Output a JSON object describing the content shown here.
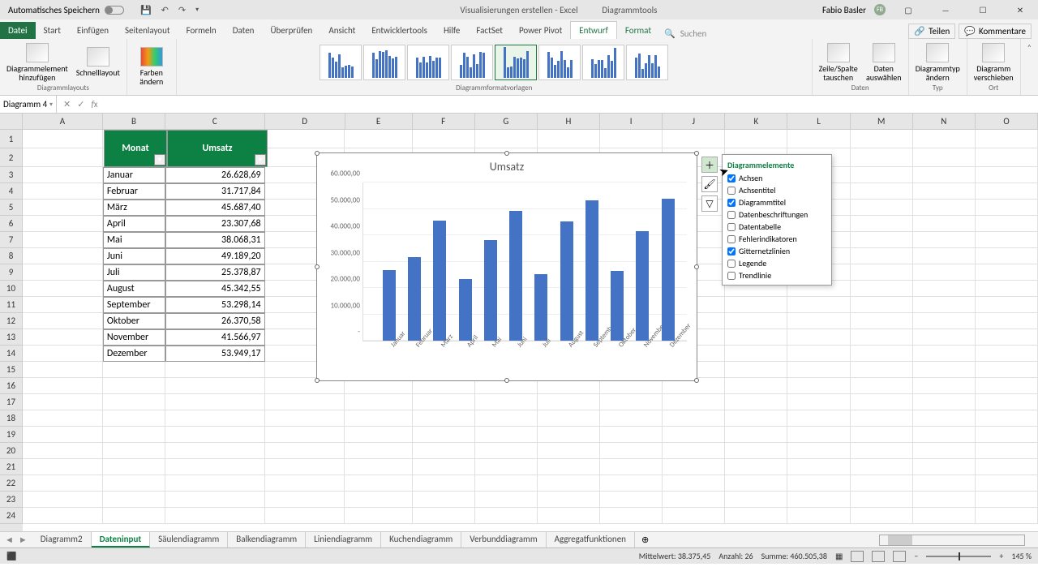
{
  "title": {
    "autosave": "Automatisches Speichern",
    "file": "Visualisierungen erstellen",
    "app": "Excel",
    "tools": "Diagrammtools",
    "user": "Fabio Basler",
    "user_initials": "FB"
  },
  "tabs": {
    "datei": "Datei",
    "start": "Start",
    "einfugen": "Einfügen",
    "seitenlayout": "Seitenlayout",
    "formeln": "Formeln",
    "daten": "Daten",
    "uberprufen": "Überprüfen",
    "ansicht": "Ansicht",
    "entwickler": "Entwicklertools",
    "hilfe": "Hilfe",
    "factset": "FactSet",
    "powerpivot": "Power Pivot",
    "entwurf": "Entwurf",
    "format": "Format",
    "search": "Suchen",
    "teilen": "Teilen",
    "kommentare": "Kommentare"
  },
  "ribbon": {
    "layouts": {
      "element": "Diagrammelement\nhinzufügen",
      "schnell": "Schnelllayout",
      "label": "Diagrammlayouts"
    },
    "farben": {
      "btn": "Farben\nändern"
    },
    "styles_label": "Diagrammformatvorlagen",
    "daten": {
      "zs": "Zeile/Spalte\ntauschen",
      "aus": "Daten\nauswählen",
      "label": "Daten"
    },
    "typ": {
      "btn": "Diagrammtyp\nändern",
      "label": "Typ"
    },
    "ort": {
      "btn": "Diagramm\nverschieben",
      "label": "Ort"
    }
  },
  "namebox": "Diagramm 4",
  "table": {
    "h1": "Monat",
    "h2": "Umsatz",
    "rows": [
      {
        "m": "Januar",
        "u": "26.628,69"
      },
      {
        "m": "Februar",
        "u": "31.717,84"
      },
      {
        "m": "März",
        "u": "45.687,40"
      },
      {
        "m": "April",
        "u": "23.307,68"
      },
      {
        "m": "Mai",
        "u": "38.068,31"
      },
      {
        "m": "Juni",
        "u": "49.189,20"
      },
      {
        "m": "Juli",
        "u": "25.378,87"
      },
      {
        "m": "August",
        "u": "45.342,55"
      },
      {
        "m": "September",
        "u": "53.298,14"
      },
      {
        "m": "Oktober",
        "u": "26.370,58"
      },
      {
        "m": "November",
        "u": "41.566,97"
      },
      {
        "m": "Dezember",
        "u": "53.949,17"
      }
    ]
  },
  "chart_data": {
    "type": "bar",
    "title": "Umsatz",
    "categories": [
      "Januar",
      "Februar",
      "März",
      "April",
      "Mai",
      "Juni",
      "Juli",
      "August",
      "September",
      "Oktober",
      "November",
      "Dezember"
    ],
    "values": [
      26628.69,
      31717.84,
      45687.4,
      23307.68,
      38068.31,
      49189.2,
      25378.87,
      45342.55,
      53298.14,
      26370.58,
      41566.97,
      53949.17
    ],
    "yticks": [
      "-",
      "10.000,00",
      "20.000,00",
      "30.000,00",
      "40.000,00",
      "50.000,00",
      "60.000,00"
    ],
    "ylim": [
      0,
      60000
    ]
  },
  "elements_panel": {
    "title": "Diagrammelemente",
    "items": [
      {
        "label": "Achsen",
        "checked": true
      },
      {
        "label": "Achsentitel",
        "checked": false
      },
      {
        "label": "Diagrammtitel",
        "checked": true
      },
      {
        "label": "Datenbeschriftungen",
        "checked": false
      },
      {
        "label": "Datentabelle",
        "checked": false
      },
      {
        "label": "Fehlerindikatoren",
        "checked": false
      },
      {
        "label": "Gitternetzlinien",
        "checked": true
      },
      {
        "label": "Legende",
        "checked": false
      },
      {
        "label": "Trendlinie",
        "checked": false
      }
    ]
  },
  "sheets": [
    "Diagramm2",
    "Dateninput",
    "Säulendiagramm",
    "Balkendiagramm",
    "Liniendiagramm",
    "Kuchendiagramm",
    "Verbunddiagramm",
    "Aggregatfunktionen"
  ],
  "sheets_active": 1,
  "status": {
    "mittelwert_l": "Mittelwert:",
    "mittelwert_v": "38.375,45",
    "anzahl_l": "Anzahl:",
    "anzahl_v": "26",
    "summe_l": "Summe:",
    "summe_v": "460.505,38",
    "zoom": "145 %"
  },
  "columns": [
    "A",
    "B",
    "C",
    "D",
    "E",
    "F",
    "G",
    "H",
    "I",
    "J",
    "K",
    "L",
    "M",
    "N",
    "O"
  ]
}
